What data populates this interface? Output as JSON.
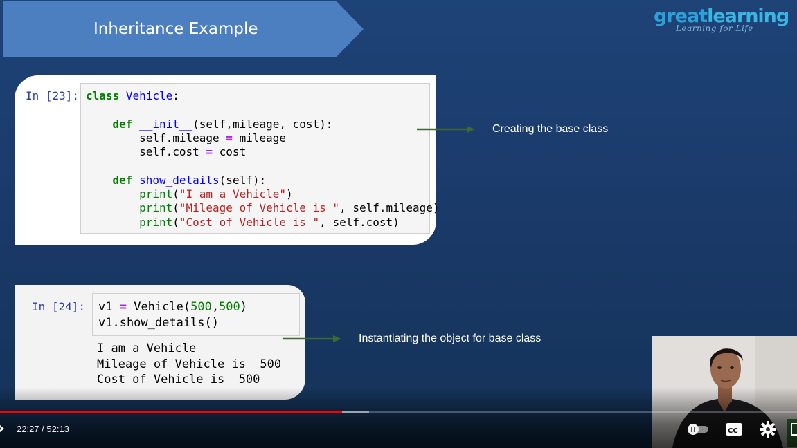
{
  "slide": {
    "title": "Inheritance Example",
    "brand": {
      "great": "great",
      "learning": "learning",
      "tagline": "Learning for Life"
    }
  },
  "cell1": {
    "prompt": "In [23]:",
    "lines": [
      "class Vehicle:",
      "",
      "    def __init__(self,mileage, cost):",
      "        self.mileage = mileage",
      "        self.cost = cost",
      "",
      "    def show_details(self):",
      "        print(\"I am a Vehicle\")",
      "        print(\"Mileage of Vehicle is \", self.mileage)",
      "        print(\"Cost of Vehicle is \", self.cost)"
    ]
  },
  "cell2": {
    "prompt": "In [24]:",
    "lines": [
      "v1 = Vehicle(500,500)",
      "v1.show_details()"
    ],
    "output": [
      "I am a Vehicle",
      "Mileage of Vehicle is  500",
      "Cost of Vehicle is  500"
    ]
  },
  "annotations": [
    {
      "text": "Creating the base class",
      "color": "#3d6b2f"
    },
    {
      "text": "Instantiating the object for base class",
      "color": "#3d6b2f"
    }
  ],
  "player": {
    "time": "22:27 / 52:13",
    "progress": 0.4296,
    "buffered": 0.463,
    "icons": [
      "play-icon",
      "autoplay-toggle-icon",
      "captions-icon",
      "settings-icon",
      "miniplayer-icon"
    ]
  }
}
